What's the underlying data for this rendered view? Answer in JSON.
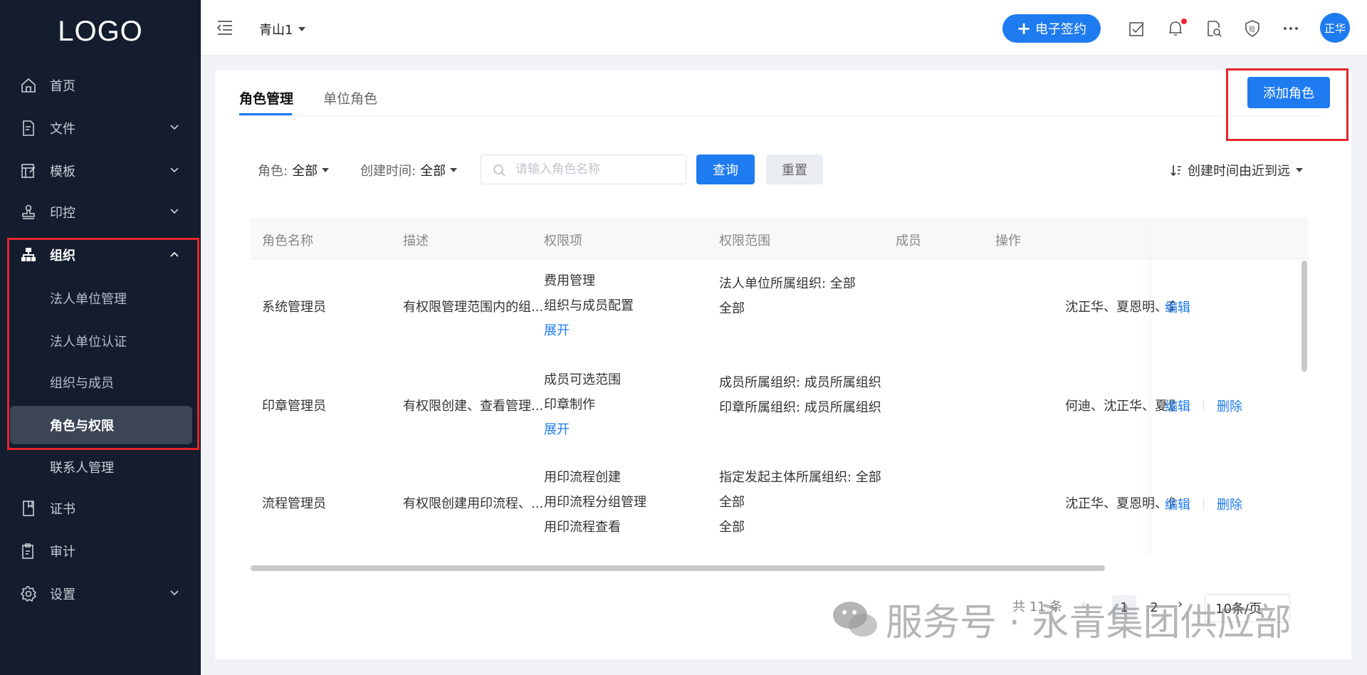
{
  "sidebar": {
    "logo": "LOGO",
    "items": [
      {
        "label": "首页",
        "icon": "home-icon"
      },
      {
        "label": "文件",
        "icon": "file-icon"
      },
      {
        "label": "模板",
        "icon": "template-icon"
      },
      {
        "label": "印控",
        "icon": "stamp-icon"
      },
      {
        "label": "组织",
        "icon": "org-icon"
      },
      {
        "label": "联系人管理"
      },
      {
        "label": "证书",
        "icon": "certificate-icon"
      },
      {
        "label": "审计",
        "icon": "audit-icon"
      },
      {
        "label": "设置",
        "icon": "settings-icon"
      }
    ],
    "org_sub": [
      {
        "label": "法人单位管理"
      },
      {
        "label": "法人单位认证"
      },
      {
        "label": "组织与成员"
      },
      {
        "label": "角色与权限"
      }
    ]
  },
  "header": {
    "org_name": "青山1",
    "esign_label": "电子签约",
    "avatar_text": "正华"
  },
  "tabs": [
    {
      "label": "角色管理"
    },
    {
      "label": "单位角色"
    }
  ],
  "add_role_label": "添加角色",
  "filters": {
    "role_label": "角色:",
    "role_value": "全部",
    "time_label": "创建时间:",
    "time_value": "全部",
    "search_placeholder": "请输入角色名称",
    "query_label": "查询",
    "reset_label": "重置",
    "sort_label": "创建时间由近到远"
  },
  "table": {
    "columns": [
      "角色名称",
      "描述",
      "权限项",
      "权限范围",
      "成员",
      "操作"
    ],
    "rows": [
      {
        "name": "系统管理员",
        "desc": "有权限管理范围内的组...",
        "perms": [
          "费用管理",
          "组织与成员配置"
        ],
        "expand": "展开",
        "scope": [
          "法人单位所属组织: 全部",
          "全部"
        ],
        "members": "沈正华、夏恩明、龚",
        "edit": "编辑"
      },
      {
        "name": "印章管理员",
        "desc": "有权限创建、查看管理...",
        "perms": [
          "成员可选范围",
          "印章制作"
        ],
        "expand": "展开",
        "scope": [
          "成员所属组织: 成员所属组织",
          "印章所属组织: 成员所属组织"
        ],
        "members": "何迪、沈正华、夏恩明",
        "edit": "编辑",
        "delete": "删除"
      },
      {
        "name": "流程管理员",
        "desc": "有权限创建用印流程、...",
        "perms": [
          "用印流程创建",
          "用印流程分组管理",
          "用印流程查看"
        ],
        "scope": [
          "指定发起主体所属组织: 全部",
          "全部",
          "全部"
        ],
        "members": "沈正华、夏恩明、何迪",
        "edit": "编辑",
        "delete": "删除"
      }
    ]
  },
  "pagination": {
    "total": "共 11 条",
    "pages": [
      "1",
      "2"
    ],
    "page_size": "10条/页"
  },
  "watermark": "服务号 · 永青集团供应部",
  "colors": {
    "primary": "#1e7bf0",
    "sidebar_bg": "#131d2e",
    "highlight": "#e5262c"
  }
}
